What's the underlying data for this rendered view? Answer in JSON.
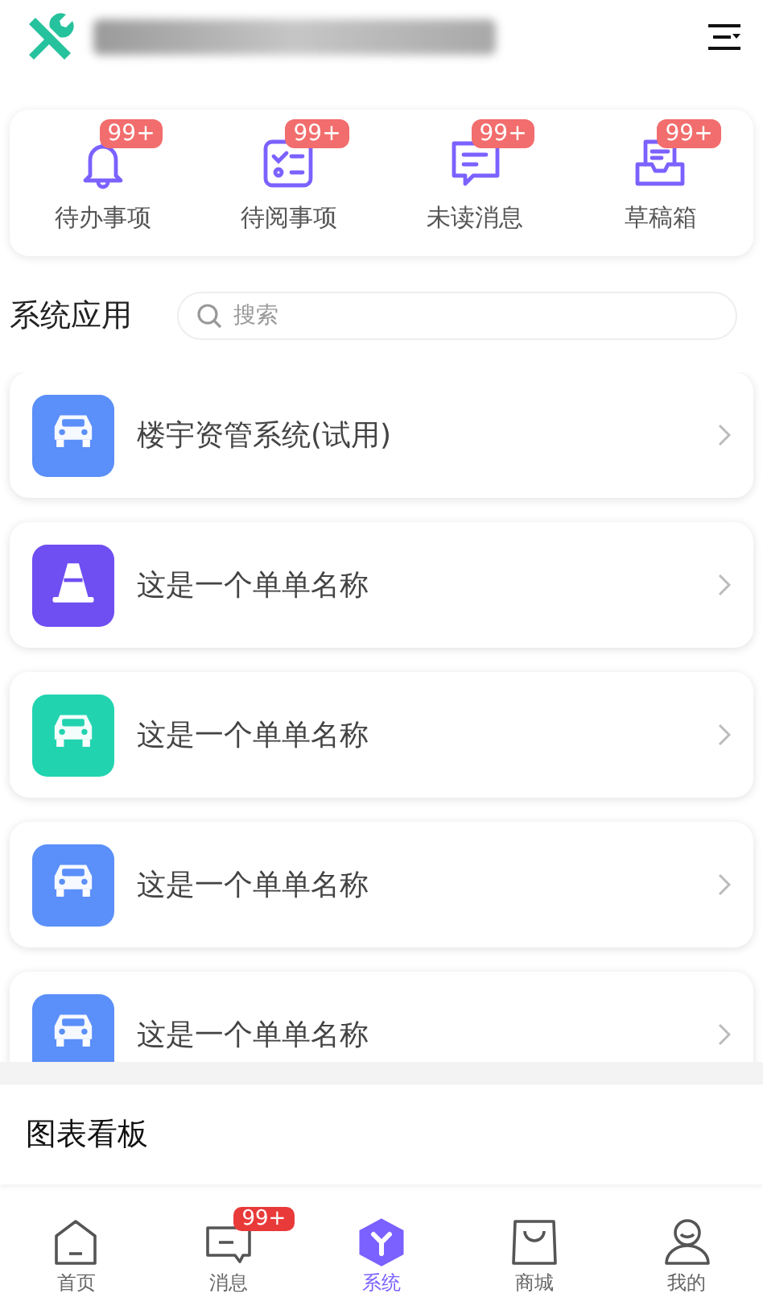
{
  "quick_items": [
    {
      "label": "待办事项",
      "badge": "99+",
      "kind": "bell"
    },
    {
      "label": "待阅事项",
      "badge": "99+",
      "kind": "checklist"
    },
    {
      "label": "未读消息",
      "badge": "99+",
      "kind": "chat"
    },
    {
      "label": "草稿箱",
      "badge": "99+",
      "kind": "inbox"
    }
  ],
  "section": {
    "title": "系统应用",
    "search": {
      "placeholder": "搜索"
    }
  },
  "apps": [
    {
      "name": "楼宇资管系统(试用)",
      "kind": "car",
      "color": "#5b8ff9"
    },
    {
      "name": "这是一个单单名称",
      "kind": "cone",
      "color": "#6f4ef2"
    },
    {
      "name": "这是一个单单名称",
      "kind": "car",
      "color": "#22d3b0"
    },
    {
      "name": "这是一个单单名称",
      "kind": "car",
      "color": "#5b8ff9"
    },
    {
      "name": "这是一个单单名称",
      "kind": "car",
      "color": "#5b8ff9"
    }
  ],
  "dashboard": {
    "title": "图表看板"
  },
  "tabs": [
    {
      "label": "首页",
      "kind": "home",
      "selected": false
    },
    {
      "label": "消息",
      "kind": "chat",
      "badge": "99+",
      "selected": false
    },
    {
      "label": "系统",
      "kind": "hex",
      "selected": true
    },
    {
      "label": "商城",
      "kind": "bag",
      "selected": false
    },
    {
      "label": "我的",
      "kind": "person",
      "selected": false
    }
  ]
}
